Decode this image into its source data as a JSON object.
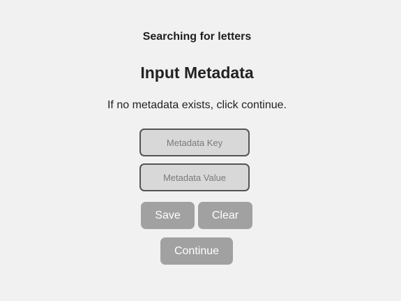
{
  "header": {
    "status": "Searching for letters",
    "title": "Input Metadata",
    "instruction": "If no metadata exists, click continue."
  },
  "form": {
    "key_placeholder": "Metadata Key",
    "key_value": "",
    "value_placeholder": "Metadata Value",
    "value_value": "",
    "save_label": "Save",
    "clear_label": "Clear",
    "continue_label": "Continue"
  },
  "colors": {
    "background": "#f1f1f1",
    "field_background": "#d8d8d8",
    "field_border": "#555555",
    "button_background": "#a1a1a1",
    "button_text": "#ffffff"
  }
}
